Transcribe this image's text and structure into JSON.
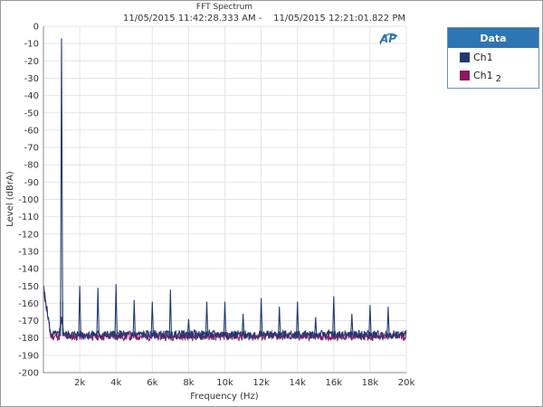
{
  "chart_data": {
    "type": "line",
    "title": "FFT Spectrum",
    "subtitle": "11/05/2015 11:42:28.333 AM -    11/05/2015 12:21:01.822 PM",
    "xlabel": "Frequency (Hz)",
    "ylabel": "Level (dBrA)",
    "xlim": [
      0,
      20000
    ],
    "ylim": [
      -200,
      0
    ],
    "x_ticks": [
      {
        "value": 2000,
        "label": "2k"
      },
      {
        "value": 4000,
        "label": "4k"
      },
      {
        "value": 6000,
        "label": "6k"
      },
      {
        "value": 8000,
        "label": "8k"
      },
      {
        "value": 10000,
        "label": "10k"
      },
      {
        "value": 12000,
        "label": "12k"
      },
      {
        "value": 14000,
        "label": "14k"
      },
      {
        "value": 16000,
        "label": "16k"
      },
      {
        "value": 18000,
        "label": "18k"
      },
      {
        "value": 20000,
        "label": "20k"
      }
    ],
    "y_ticks": [
      0,
      -10,
      -20,
      -30,
      -40,
      -50,
      -60,
      -70,
      -80,
      -90,
      -100,
      -110,
      -120,
      -130,
      -140,
      -150,
      -160,
      -170,
      -180,
      -190,
      -200
    ],
    "grid": true,
    "legend_position": "right",
    "series": [
      {
        "name": "Ch1",
        "color": "#1f3a73",
        "peaks": [
          {
            "x": 1000,
            "y": -7
          },
          {
            "x": 2000,
            "y": -150
          },
          {
            "x": 3000,
            "y": -151
          },
          {
            "x": 4000,
            "y": -149
          },
          {
            "x": 5000,
            "y": -158
          },
          {
            "x": 6000,
            "y": -159
          },
          {
            "x": 7000,
            "y": -152
          },
          {
            "x": 8000,
            "y": -169
          },
          {
            "x": 9000,
            "y": -159
          },
          {
            "x": 10000,
            "y": -159
          },
          {
            "x": 11000,
            "y": -166
          },
          {
            "x": 12000,
            "y": -157
          },
          {
            "x": 13000,
            "y": -162
          },
          {
            "x": 14000,
            "y": -159
          },
          {
            "x": 15000,
            "y": -168
          },
          {
            "x": 16000,
            "y": -156
          },
          {
            "x": 17000,
            "y": -166
          },
          {
            "x": 18000,
            "y": -161
          },
          {
            "x": 19000,
            "y": -162
          }
        ],
        "noise_floor": -178
      },
      {
        "name": "Ch1",
        "name_subscript": "2",
        "color": "#8b1a5e",
        "noise_floor": -179
      }
    ]
  },
  "legend": {
    "header": "Data",
    "items": [
      {
        "label": "Ch1",
        "subscript": "",
        "color": "#1f3a73"
      },
      {
        "label": "Ch1",
        "subscript": "2",
        "color": "#8b1a5e"
      }
    ]
  },
  "logo_text": "AP"
}
